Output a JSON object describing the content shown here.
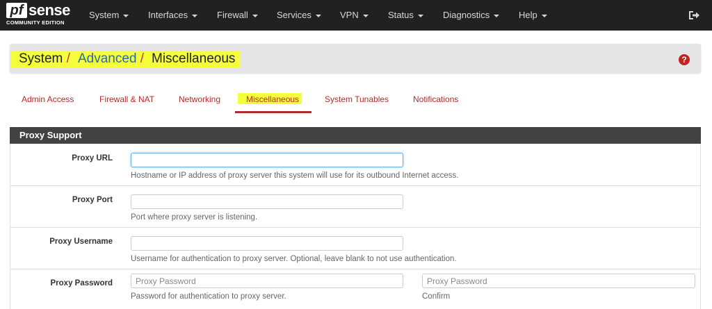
{
  "navbar": {
    "logo": {
      "pf": "pf",
      "sense": "sense",
      "edition": "COMMUNITY EDITION"
    },
    "items": [
      "System",
      "Interfaces",
      "Firewall",
      "Services",
      "VPN",
      "Status",
      "Diagnostics",
      "Help"
    ],
    "logout_icon": "sign-out-icon"
  },
  "breadcrumb": {
    "system": "System",
    "advanced": "Advanced",
    "misc": "Miscellaneous",
    "separator": "/",
    "help_icon": "question-circle-icon"
  },
  "tabs": [
    "Admin Access",
    "Firewall & NAT",
    "Networking",
    "Miscellaneous",
    "System Tunables",
    "Notifications"
  ],
  "active_tab": "Miscellaneous",
  "panel": {
    "title": "Proxy Support",
    "rows": {
      "url": {
        "label": "Proxy URL",
        "value": "",
        "help": "Hostname or IP address of proxy server this system will use for its outbound Internet access."
      },
      "port": {
        "label": "Proxy Port",
        "value": "",
        "help": "Port where proxy server is listening."
      },
      "username": {
        "label": "Proxy Username",
        "value": "",
        "help": "Username for authentication to proxy server. Optional, leave blank to not use authentication."
      },
      "password": {
        "label": "Proxy Password",
        "placeholder": "Proxy Password",
        "help": "Password for authentication to proxy server.",
        "confirm_placeholder": "Proxy Password",
        "confirm_help": "Confirm"
      }
    }
  },
  "colors": {
    "navbar": "#212121",
    "accent": "#b22b2b",
    "link": "#2b6aa3",
    "highlight": "#f5ff3c",
    "panel_header": "#424242"
  }
}
